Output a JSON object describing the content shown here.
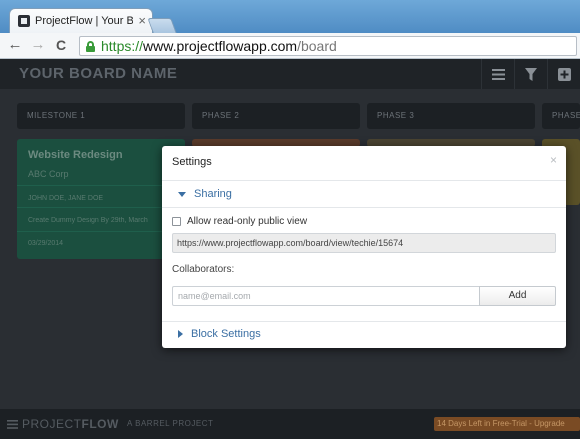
{
  "browser": {
    "tab_title": "ProjectFlow | Your Board N",
    "tab_close": "×",
    "url_scheme": "https://",
    "url_host": "www.projectflowapp.com",
    "url_path": "/board",
    "back_label": "←",
    "forward_label": "→",
    "reload_label": "C"
  },
  "app": {
    "board_title": "YOUR BOARD NAME",
    "columns": [
      "MILESTONE 1",
      "PHASE 2",
      "PHASE 3",
      "PHASE"
    ],
    "card": {
      "title": "Website Redesign",
      "client": "ABC Corp",
      "people": "JOHN DOE, JANE DOE",
      "task": "Create Dummy Design By 29th, March",
      "date": "03/29/2014"
    },
    "footer": {
      "logo_light": "PROJECT",
      "logo_bold": "FLOW",
      "sub": "A BARREL PROJECT",
      "trial": "14 Days Left in Free-Trial - Upgrade"
    },
    "colors": {
      "card_green": "#1b4f3f",
      "link_blue": "#3b6fa3"
    }
  },
  "modal": {
    "title": "Settings",
    "close": "×",
    "sharing_label": "Sharing",
    "public_view_label": "Allow read-only public view",
    "public_url": "https://www.projectflowapp.com/board/view/techie/15674",
    "collaborators_label": "Collaborators:",
    "email_placeholder": "name@email.com",
    "add_label": "Add",
    "block_settings_label": "Block Settings"
  }
}
